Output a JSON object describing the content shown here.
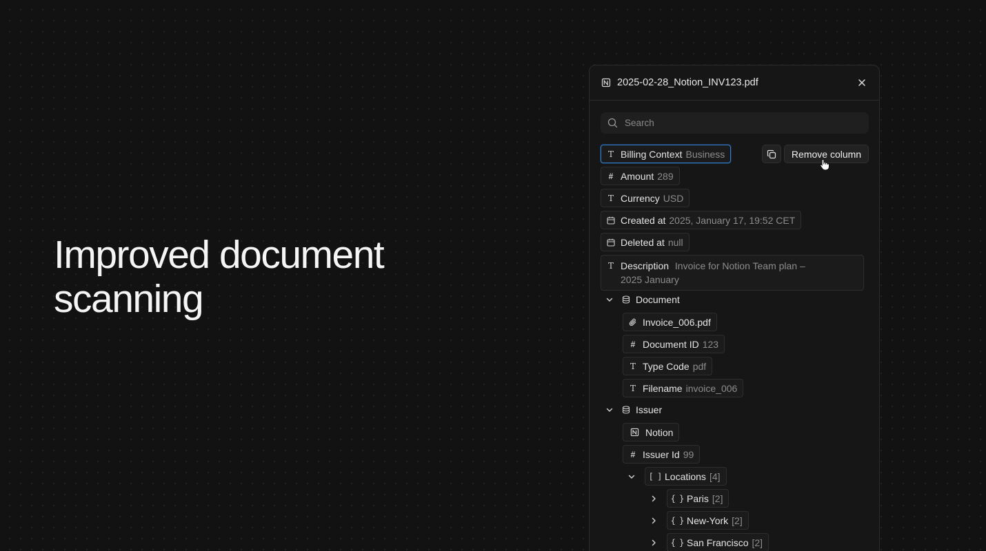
{
  "headline": {
    "line1": "Improved document",
    "line2": "scanning"
  },
  "panel": {
    "title": "2025-02-28_Notion_INV123.pdf",
    "search_placeholder": "Search",
    "actions": {
      "remove_column_label": "Remove column"
    },
    "fields": [
      {
        "type": "text",
        "label": "Billing Context",
        "value": "Business"
      },
      {
        "type": "number",
        "label": "Amount",
        "value": "289"
      },
      {
        "type": "text",
        "label": "Currency",
        "value": "USD"
      },
      {
        "type": "date",
        "label": "Created at",
        "value": "2025, January 17, 19:52 CET"
      },
      {
        "type": "date",
        "label": "Deleted at",
        "value": "null"
      },
      {
        "type": "text",
        "label": "Description",
        "value": "Invoice for Notion Team plan –",
        "value2": "2025 January"
      }
    ],
    "document": {
      "label": "Document",
      "items": [
        {
          "type": "attachment",
          "label": "Invoice_006.pdf",
          "value": ""
        },
        {
          "type": "number",
          "label": "Document ID",
          "value": "123"
        },
        {
          "type": "text",
          "label": "Type Code",
          "value": "pdf"
        },
        {
          "type": "text",
          "label": "Filename",
          "value": "invoice_006"
        }
      ]
    },
    "issuer": {
      "label": "Issuer",
      "notion_label": "Notion",
      "issuer_id": {
        "label": "Issuer Id",
        "value": "99"
      },
      "locations": {
        "label": "Locations",
        "count": "[4]",
        "items": [
          {
            "label": "Paris",
            "count": "[2]"
          },
          {
            "label": "New-York",
            "count": "[2]"
          },
          {
            "label": "San Francisco",
            "count": "[2]"
          }
        ]
      }
    }
  },
  "colors": {
    "background": "#121212",
    "panel": "#161616",
    "selected_border": "#2f7fd3",
    "muted_text": "#8d8d8d"
  },
  "icons": {
    "text_field": "T-glyph-icon",
    "number_field": "hash-icon",
    "date_field": "calendar-icon",
    "group": "database-icon",
    "object": "braces-icon",
    "array": "brackets-icon",
    "attachment": "paperclip-icon",
    "copy": "copy-icon",
    "close": "close-icon",
    "search": "search-icon"
  }
}
